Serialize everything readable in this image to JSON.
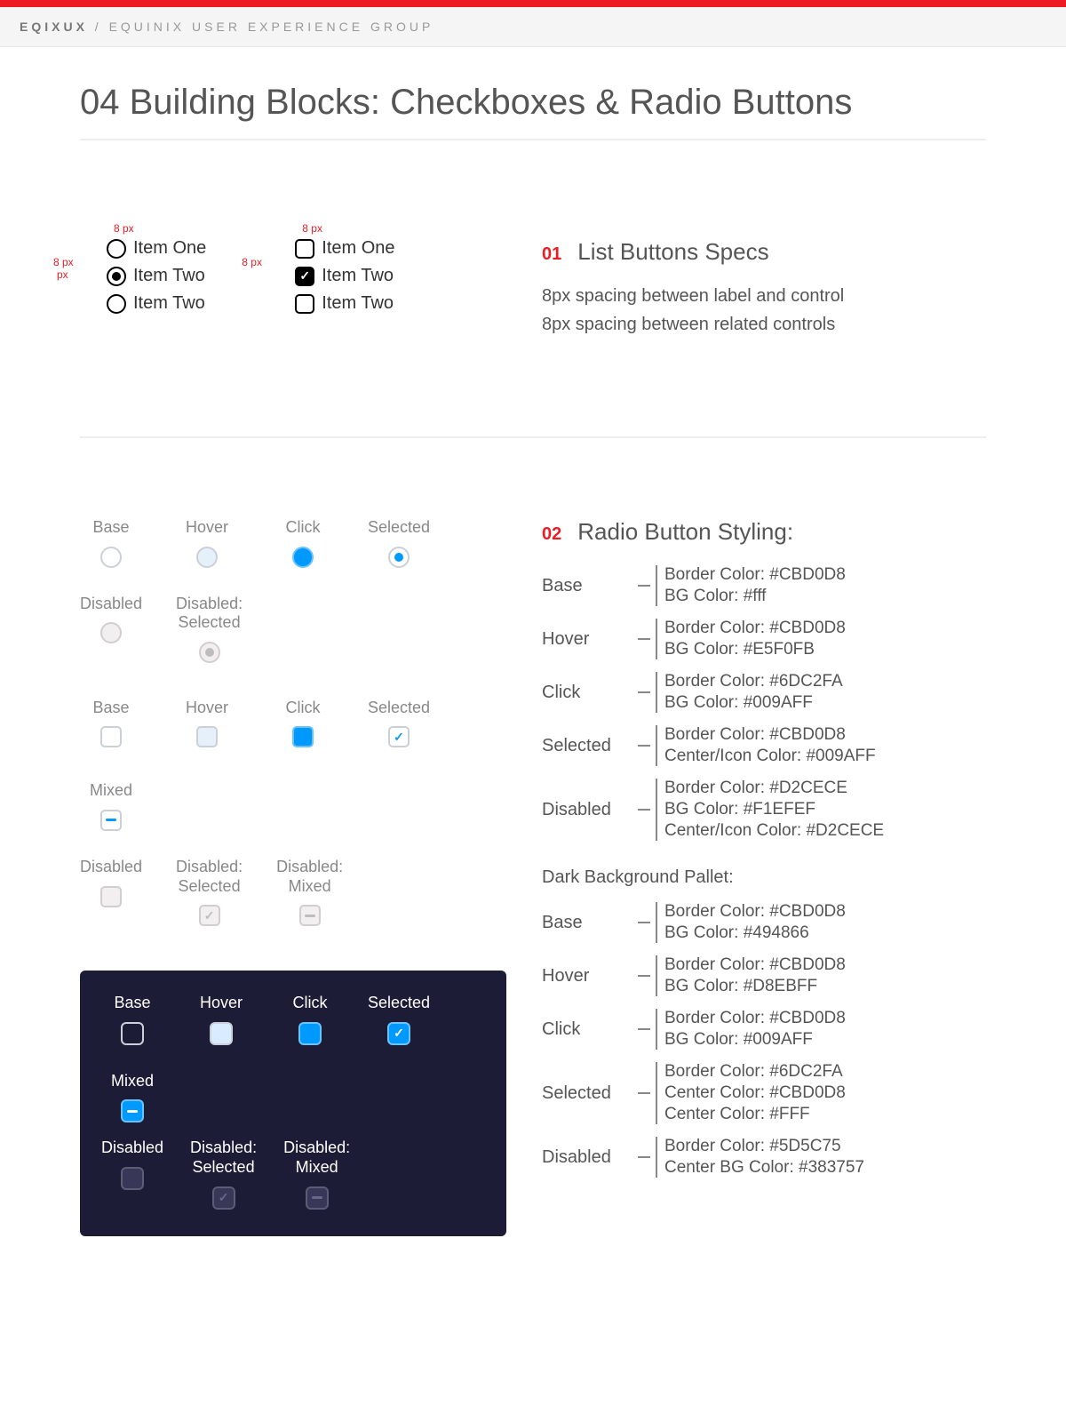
{
  "header": {
    "brand": "EQIXUX",
    "sep": " / ",
    "sub": "EQUINIX USER EXPERIENCE GROUP"
  },
  "page_title": "04 Building Blocks: Checkboxes & Radio Buttons",
  "section1": {
    "num": "01",
    "title": "List Buttons Specs",
    "spec1": "8px spacing between label and control",
    "spec2": "8px spacing between related controls",
    "radio_items": [
      "Item One",
      "Item Two",
      "Item Two"
    ],
    "check_items": [
      "Item One",
      "Item Two",
      "Item Two"
    ],
    "anno_horiz": "8 px",
    "anno_vert_top": "8 px",
    "anno_vert_bottom": "px"
  },
  "section2": {
    "num": "02",
    "title": "Radio Button Styling:",
    "radio_states": [
      "Base",
      "Hover",
      "Click",
      "Selected"
    ],
    "radio_disabled_states": [
      "Disabled",
      "Disabled:\nSelected"
    ],
    "checkbox_states": [
      "Base",
      "Hover",
      "Click",
      "Selected",
      "Mixed"
    ],
    "checkbox_disabled_states": [
      "Disabled",
      "Disabled:\nSelected",
      "Disabled:\nMixed"
    ],
    "dark_states": [
      "Base",
      "Hover",
      "Click",
      "Selected",
      "Mixed"
    ],
    "dark_disabled_states": [
      "Disabled",
      "Disabled:\nSelected",
      "Disabled:\nMixed"
    ],
    "specs_light": [
      {
        "name": "Base",
        "lines": [
          "Border Color: #CBD0D8",
          "BG Color: #fff"
        ]
      },
      {
        "name": "Hover",
        "lines": [
          "Border Color: #CBD0D8",
          "BG Color: #E5F0FB"
        ]
      },
      {
        "name": "Click",
        "lines": [
          "Border Color: #6DC2FA",
          "BG Color: #009AFF"
        ]
      },
      {
        "name": "Selected",
        "lines": [
          "Border Color: #CBD0D8",
          "Center/Icon Color: #009AFF"
        ]
      },
      {
        "name": "Disabled",
        "lines": [
          "Border Color: #D2CECE",
          "BG Color: #F1EFEF",
          "Center/Icon Color: #D2CECE"
        ]
      }
    ],
    "dark_heading": "Dark Background Pallet:",
    "specs_dark": [
      {
        "name": "Base",
        "lines": [
          "Border Color: #CBD0D8",
          "BG Color: #494866"
        ]
      },
      {
        "name": "Hover",
        "lines": [
          "Border Color: #CBD0D8",
          "BG Color: #D8EBFF"
        ]
      },
      {
        "name": "Click",
        "lines": [
          "Border Color: #CBD0D8",
          "BG Color: #009AFF"
        ]
      },
      {
        "name": "Selected",
        "lines": [
          "Border Color: #6DC2FA",
          "Center Color: #CBD0D8",
          "Center Color: #FFF"
        ]
      },
      {
        "name": "Disabled",
        "lines": [
          "Border Color: #5D5C75",
          "Center BG Color: #383757"
        ]
      }
    ]
  }
}
